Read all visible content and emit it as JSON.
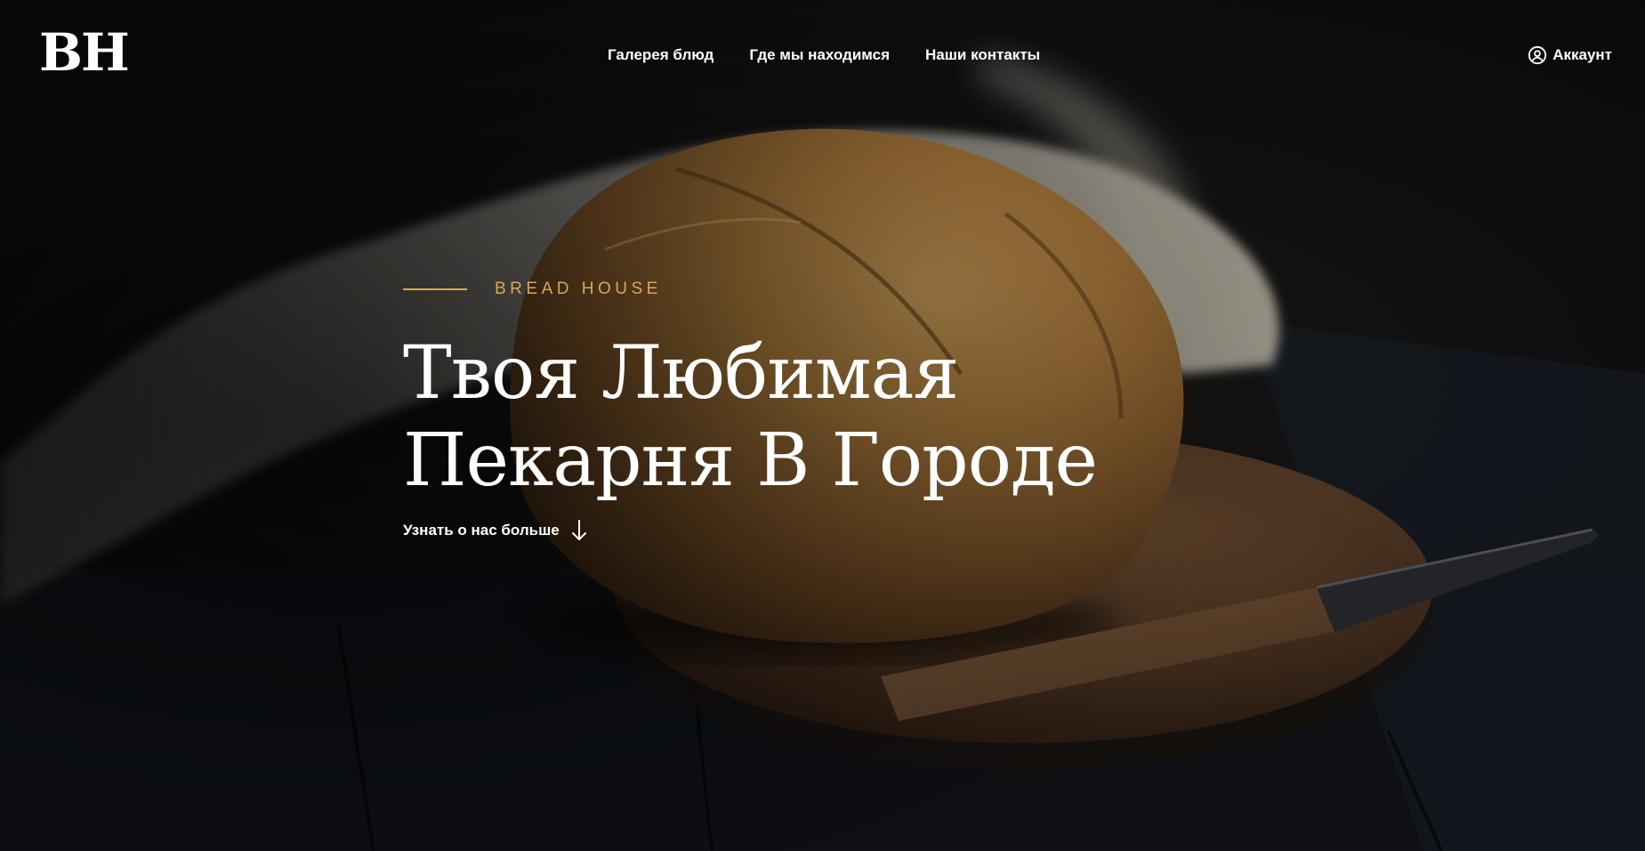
{
  "header": {
    "logo": "BH",
    "nav": [
      {
        "label": "Галерея блюд"
      },
      {
        "label": "Где мы находимся"
      },
      {
        "label": "Наши контакты"
      }
    ],
    "account": {
      "label": "Аккаунт",
      "icon": "user-circle-icon"
    }
  },
  "hero": {
    "eyebrow": "BREAD HOUSE",
    "headline_lines": [
      "Твоя Любимая",
      "Пекарня В Городе"
    ],
    "cta": {
      "label": "Узнать о нас больше",
      "icon": "arrow-down-icon"
    }
  },
  "colors": {
    "accent": "#d8a85a",
    "background": "#0b0b0d",
    "text": "#ffffff"
  }
}
